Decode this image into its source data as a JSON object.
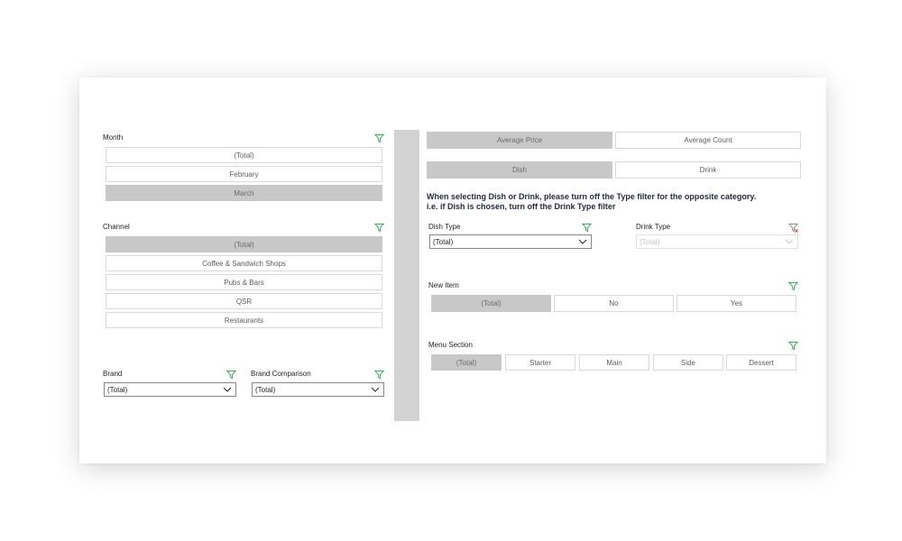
{
  "month": {
    "title": "Month",
    "items": [
      {
        "label": "(Total)",
        "selected": false
      },
      {
        "label": "February",
        "selected": false
      },
      {
        "label": "March",
        "selected": true
      }
    ]
  },
  "channel": {
    "title": "Channel",
    "items": [
      {
        "label": "(Total)",
        "selected": true
      },
      {
        "label": "Coffee & Sandwich Shops",
        "selected": false
      },
      {
        "label": "Pubs & Bars",
        "selected": false
      },
      {
        "label": "QSR",
        "selected": false
      },
      {
        "label": "Restaurants",
        "selected": false
      }
    ]
  },
  "brand": {
    "title": "Brand",
    "value": "(Total)"
  },
  "brand_comparison": {
    "title": "Brand Comparison",
    "value": "(Total)"
  },
  "metric_toggle": {
    "options": [
      {
        "label": "Average Price",
        "selected": true
      },
      {
        "label": "Average Count",
        "selected": false
      }
    ]
  },
  "type_toggle": {
    "options": [
      {
        "label": "Dish",
        "selected": true
      },
      {
        "label": "Drink",
        "selected": false
      }
    ]
  },
  "instruction": {
    "line1": "When selecting Dish or Drink, please turn off the Type filter for the opposite category.",
    "line2": "i.e. if Dish is chosen, turn off the Drink Type filter"
  },
  "dish_type": {
    "title": "Dish Type",
    "value": "(Total)"
  },
  "drink_type": {
    "title": "Drink Type",
    "value": "(Total)",
    "disabled": true
  },
  "new_item": {
    "title": "New Item",
    "items": [
      {
        "label": "(Total)",
        "selected": true
      },
      {
        "label": "No",
        "selected": false
      },
      {
        "label": "Yes",
        "selected": false
      }
    ]
  },
  "menu_section": {
    "title": "Menu Section",
    "items": [
      {
        "label": "(Total)",
        "selected": true
      },
      {
        "label": "Starter",
        "selected": false
      },
      {
        "label": "Main",
        "selected": false
      },
      {
        "label": "Side",
        "selected": false
      },
      {
        "label": "Dessert",
        "selected": false
      }
    ]
  },
  "icons": {
    "filter": "filter-icon",
    "filter_clear": "filter-clear-icon",
    "chevron": "chevron-down-icon"
  },
  "colors": {
    "accent_green": "#2ba84a",
    "clear_red": "#d13438",
    "selected_tile": "#c8c8c8",
    "divider": "#d2d2d2"
  }
}
